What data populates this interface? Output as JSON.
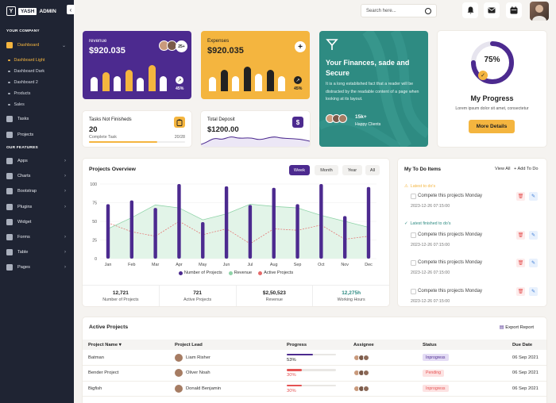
{
  "brand": {
    "logo_letter": "Y",
    "name_a": "YASH",
    "name_b": "ADMIN"
  },
  "sidebar": {
    "company_label": "YOUR COMPANY",
    "features_label": "OUR FEATURES",
    "dashboard": "Dashboard",
    "subitems": [
      "Dashboard Light",
      "Dashboard Dark",
      "Dashboard 2",
      "Products",
      "Sales"
    ],
    "tasks": "Tasks",
    "projects": "Projects",
    "features": [
      "Apps",
      "Charts",
      "Bootstrap",
      "Plugins",
      "Widget",
      "Forms",
      "Table",
      "Pages"
    ]
  },
  "topbar": {
    "search_placeholder": "Search here..."
  },
  "revenue": {
    "title": "revenue",
    "value": "$920.035",
    "badge": "25+",
    "pct": "45%",
    "bars": [
      0.48,
      0.62,
      0.5,
      0.72,
      0.46,
      0.88,
      0.5
    ]
  },
  "expenses": {
    "title": "Expenses",
    "value": "$920.035",
    "pct": "45%",
    "bars": [
      0.48,
      0.72,
      0.5,
      0.82,
      0.58,
      0.72,
      0.5
    ]
  },
  "finance": {
    "title": "Your Finances, sade and Secure",
    "text": "It is a long established fact that a reader will be distracted by the readable content of a page when looking at its layout.",
    "count": "15k+",
    "label": "Happy Clients"
  },
  "progress": {
    "percent": "75%",
    "value": 0.75,
    "title": "My Progress",
    "subtitle": "Lorem ipsum dolor sit amet, consectetur",
    "button": "More Details"
  },
  "tasks_card": {
    "title": "Tasks Not Finisheds",
    "value": "20",
    "label": "Complete Task",
    "count": "20/28",
    "fill": 0.71
  },
  "deposit_card": {
    "title": "Total Deposit",
    "value": "$1200.00"
  },
  "overview": {
    "title": "Projects Overview",
    "tabs": [
      "Week",
      "Month",
      "Year",
      "All"
    ],
    "stats": [
      {
        "value": "12,721",
        "label": "Number of Projects"
      },
      {
        "value": "721",
        "label": "Active Projects"
      },
      {
        "value": "$2,50,523",
        "label": "Revenue"
      },
      {
        "value": "12,275h",
        "label": "Working Hours"
      }
    ]
  },
  "chart_data": {
    "type": "bar",
    "categories": [
      "Jan",
      "Feb",
      "Mar",
      "Apr",
      "May",
      "Jun",
      "Jul",
      "Aug",
      "Sep",
      "Oct",
      "Nov",
      "Dec"
    ],
    "ylim": [
      0,
      100
    ],
    "yticks": [
      0,
      25,
      50,
      75,
      100
    ],
    "series": [
      {
        "name": "Number of Projects",
        "type": "bar",
        "color": "#4c2a8f",
        "values": [
          73,
          78,
          68,
          100,
          49,
          97,
          72,
          95,
          73,
          100,
          57,
          96
        ]
      },
      {
        "name": "Revenue",
        "type": "area",
        "color": "#8fd3a8",
        "values": [
          40,
          55,
          72,
          68,
          52,
          60,
          73,
          70,
          68,
          58,
          50,
          42
        ]
      },
      {
        "name": "Active Projects",
        "type": "line",
        "color": "#e46a6a",
        "values": [
          48,
          36,
          30,
          50,
          32,
          40,
          20,
          40,
          38,
          45,
          26,
          30
        ]
      }
    ]
  },
  "todo": {
    "title": "My To Do Items",
    "view_all": "View All",
    "add": "+ Add To Do",
    "section_latest": "Latest to do's",
    "section_finished": "Latest finished to do's",
    "items": [
      {
        "text": "Compete this projects Monday",
        "date": "2023-12-26 07:15:00"
      },
      {
        "text": "Compete this projects Monday",
        "date": "2023-12-26 07:15:00"
      },
      {
        "text": "Compete this projects Monday",
        "date": "2023-12-26 07:15:00"
      },
      {
        "text": "Compete this projects Monday",
        "date": "2023-12-26 07:15:00"
      }
    ]
  },
  "active_projects": {
    "title": "Active Projects",
    "export": "Export Report",
    "headers": [
      "Project Name",
      "Project Lead",
      "Progress",
      "Assignee",
      "Status",
      "Due Date"
    ],
    "rows": [
      {
        "name": "Batman",
        "lead": "Liam Risher",
        "progress": "53%",
        "fill": 0.53,
        "bar_color": "#4c2a8f",
        "pct_color": "#222",
        "status": "Inprogress",
        "status_bg": "#e4dcf5",
        "status_fg": "#4c2a8f",
        "due": "06 Sep 2021"
      },
      {
        "name": "Bender Project",
        "lead": "Oliver Noah",
        "progress": "30%",
        "fill": 0.3,
        "bar_color": "#e55353",
        "pct_color": "#e55353",
        "status": "Pending",
        "status_bg": "#fde2e2",
        "status_fg": "#e55353",
        "due": "06 Sep 2021"
      },
      {
        "name": "Bigfish",
        "lead": "Donald Benjamin",
        "progress": "30%",
        "fill": 0.3,
        "bar_color": "#e55353",
        "pct_color": "#e55353",
        "status": "Inprogress",
        "status_bg": "#fde2e2",
        "status_fg": "#e55353",
        "due": "06 Sep 2021"
      }
    ]
  }
}
